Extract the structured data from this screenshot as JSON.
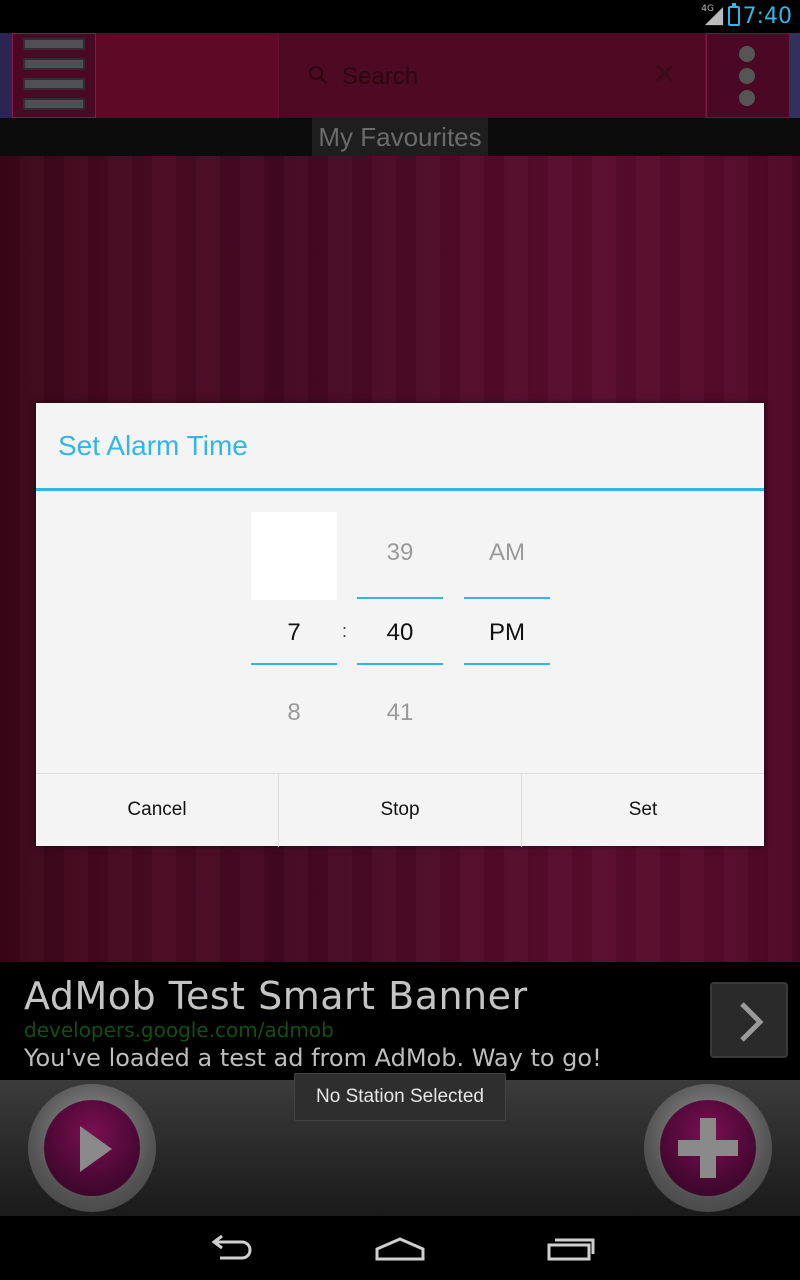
{
  "status_bar": {
    "time": "7:40",
    "network_label": "4G",
    "accent_color": "#33b5e5"
  },
  "action_bar": {
    "search_placeholder": "Search",
    "menu_icon": "hamburger-menu-icon",
    "overflow_icon": "overflow-dots-icon"
  },
  "page_title": "My Favourites",
  "dialog": {
    "title": "Set Alarm Time",
    "hour": {
      "prev": "",
      "current": "7",
      "next": "8"
    },
    "separator": ":",
    "minute": {
      "prev": "39",
      "current": "40",
      "next": "41"
    },
    "ampm": {
      "prev": "AM",
      "current": "PM",
      "next": ""
    },
    "buttons": {
      "cancel": "Cancel",
      "stop": "Stop",
      "set": "Set"
    }
  },
  "ad": {
    "title": "AdMob Test Smart Banner",
    "url": "developers.google.com/admob",
    "description": "You've loaded a test ad from AdMob. Way to go!"
  },
  "toast": "No Station Selected",
  "player": {
    "play_icon": "play-icon",
    "add_icon": "add-icon"
  },
  "nav_bar": {
    "back_icon": "back-icon",
    "home_icon": "home-icon",
    "recents_icon": "recents-icon"
  }
}
